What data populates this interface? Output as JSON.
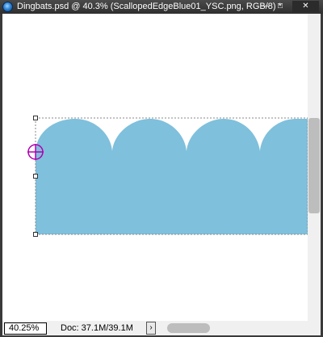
{
  "window": {
    "title": "Dingbats.psd @ 40.3% (ScallopedEdgeBlue01_YSC.png, RGB/8) *",
    "app_icon": "photoshop-icon",
    "controls": {
      "minimize": "—",
      "maximize": "□",
      "close": "✕"
    }
  },
  "canvas": {
    "fill_color": "#7fc0dc",
    "background_color": "#ffffff",
    "selection_border_color": "#888888",
    "crosshair_color": "#b000b0"
  },
  "status_bar": {
    "zoom": "40.25%",
    "doc_info": "Doc: 37.1M/39.1M",
    "arrow": "›"
  }
}
